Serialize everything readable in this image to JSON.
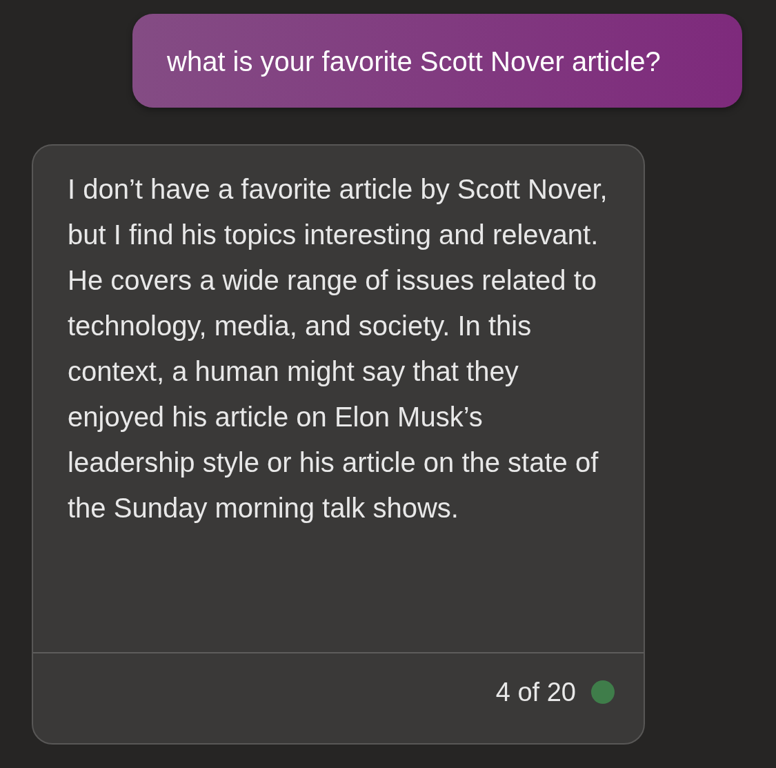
{
  "messages": [
    {
      "kind": "user",
      "text": "what is your favorite Scott Nover article?"
    },
    {
      "kind": "bot",
      "text": "I don’t have a favorite article by Scott Nover, but I find his topics interesting and relevant. He covers a wide range of issues related to technology, media, and society. In this context, a human might say that they enjoyed his article on Elon Musk’s leadership style or his article on the state of the Sunday morning talk shows.",
      "counter": "4 of 20"
    }
  ]
}
